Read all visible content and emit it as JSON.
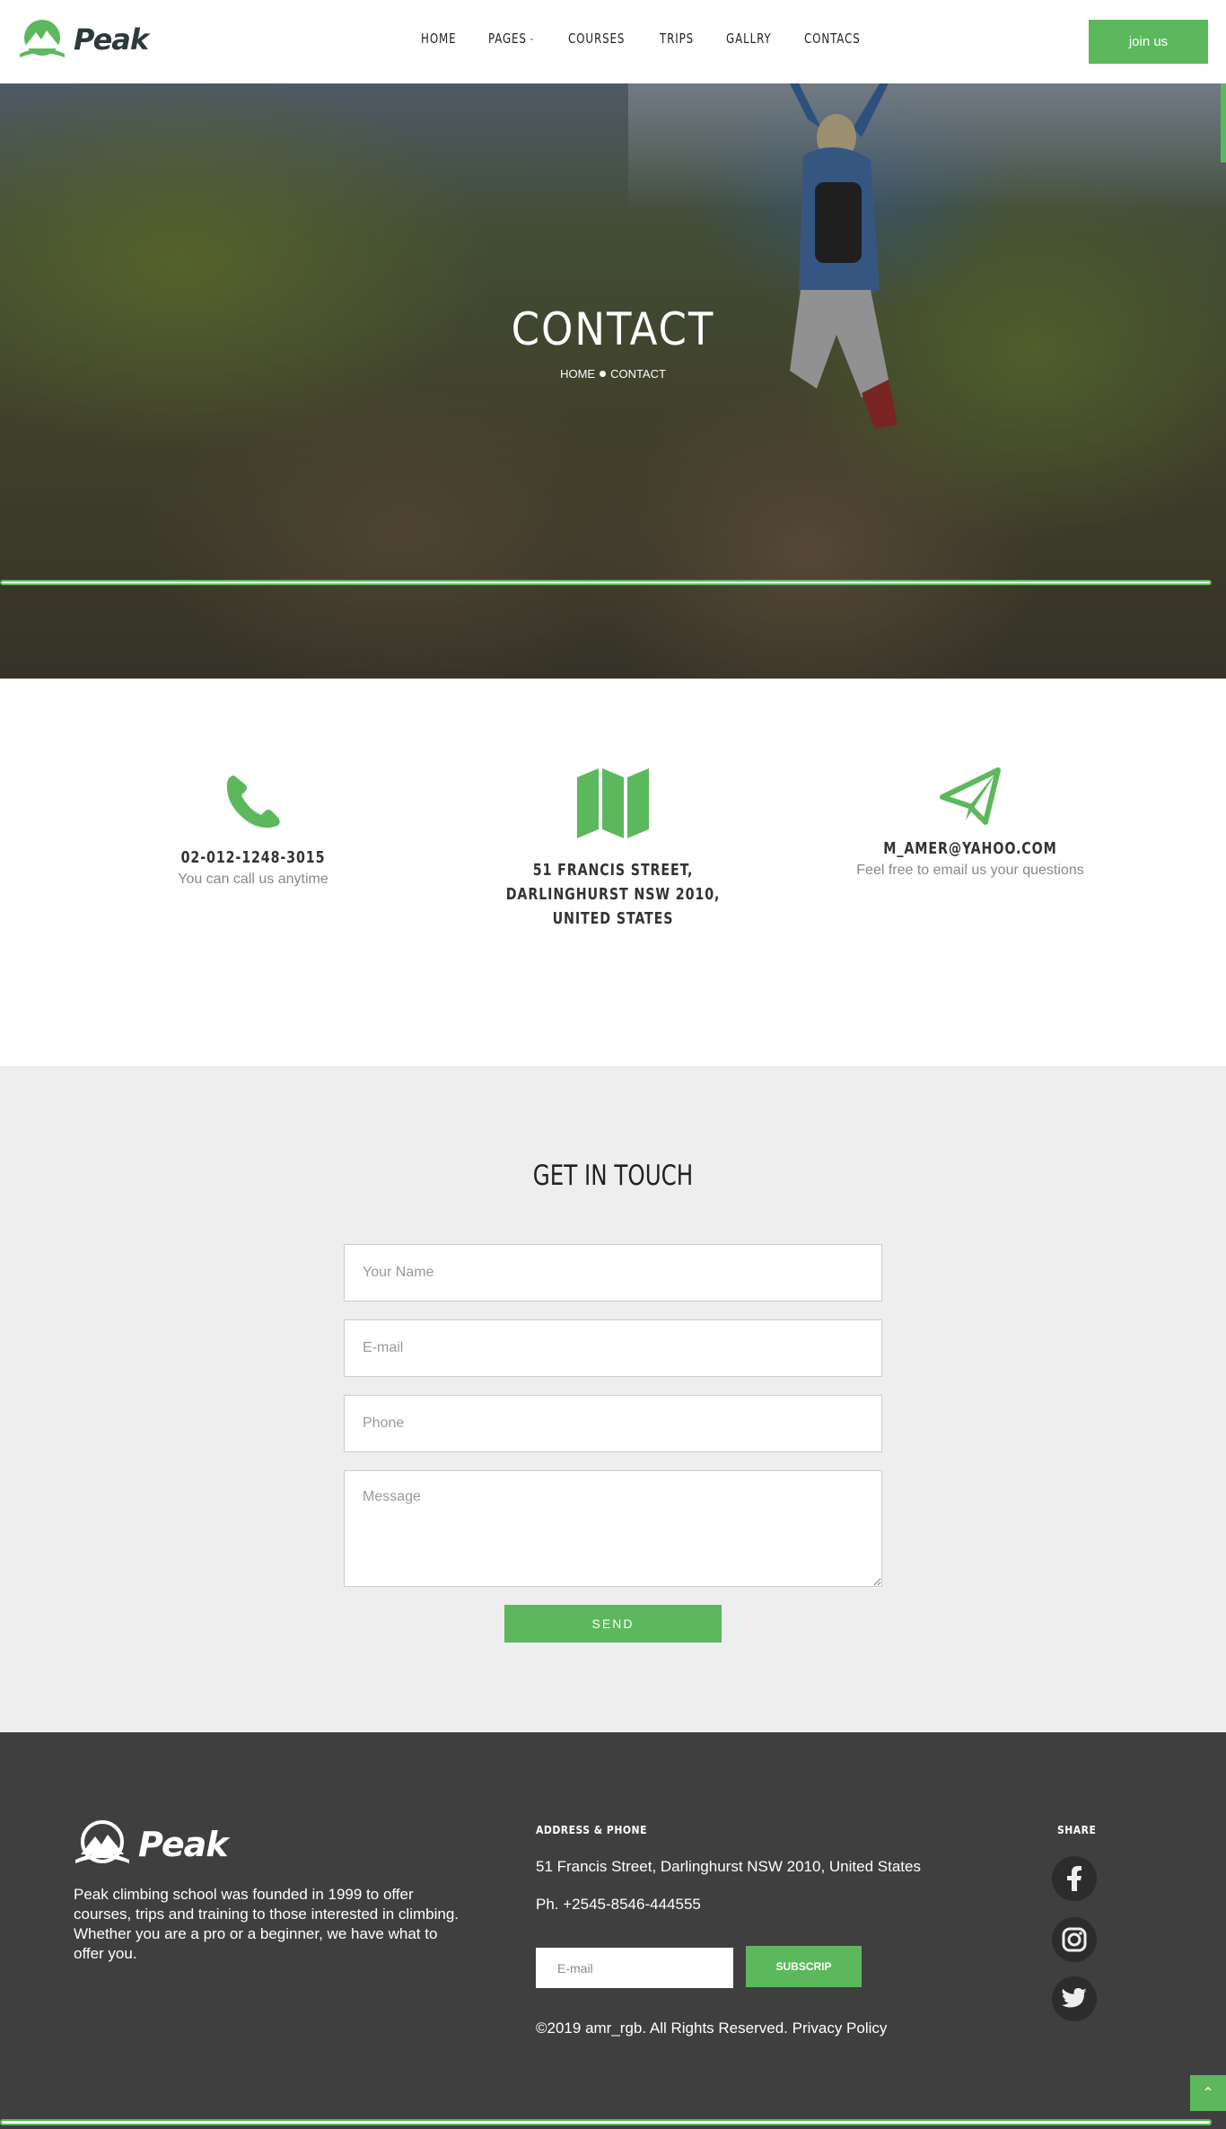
{
  "brand": {
    "name": "Peak",
    "accent": "#5cb85c"
  },
  "nav": {
    "items": [
      {
        "label": "HOME"
      },
      {
        "label": "PAGES",
        "has_dropdown": true
      },
      {
        "label": "COURSES"
      },
      {
        "label": "TRIPS"
      },
      {
        "label": "GALLRY"
      },
      {
        "label": "CONTACS"
      }
    ],
    "join_label": "join us"
  },
  "hero": {
    "title": "CONTACT",
    "breadcrumb": [
      "HOME",
      "CONTACT"
    ]
  },
  "contact_info": [
    {
      "icon": "phone-icon",
      "title": "02-012-1248-3015",
      "subtitle": "You can call us anytime"
    },
    {
      "icon": "map-icon",
      "title_lines": [
        "51 FRANCIS STREET,",
        "DARLINGHURST NSW 2010,",
        "UNITED STATES"
      ]
    },
    {
      "icon": "paper-plane-icon",
      "title": "M_AMER@YAHOO.COM",
      "subtitle": "Feel free to email us your questions"
    }
  ],
  "form": {
    "title": "GET IN TOUCH",
    "name_placeholder": "Your Name",
    "email_placeholder": "E-mail",
    "phone_placeholder": "Phone",
    "message_placeholder": "Message",
    "send_label": "SEND"
  },
  "footer": {
    "about": "Peak climbing school was founded in 1999 to offer courses, trips and training to those interested in climbing. Whether you are a pro or a beginner, we have what to offer you.",
    "address_heading": "ADDRESS & PHONE",
    "address": "51 Francis Street, Darlinghurst NSW 2010, United States",
    "phone": "Ph. +2545-8546-444555",
    "email_placeholder": "E-mail",
    "subscribe_label": "SUBSCRIP",
    "copyright": "©2019 amr_rgb. All Rights Reserved. Privacy Policy",
    "share_heading": "SHARE",
    "social": [
      "facebook-icon",
      "instagram-icon",
      "twitter-icon"
    ]
  }
}
